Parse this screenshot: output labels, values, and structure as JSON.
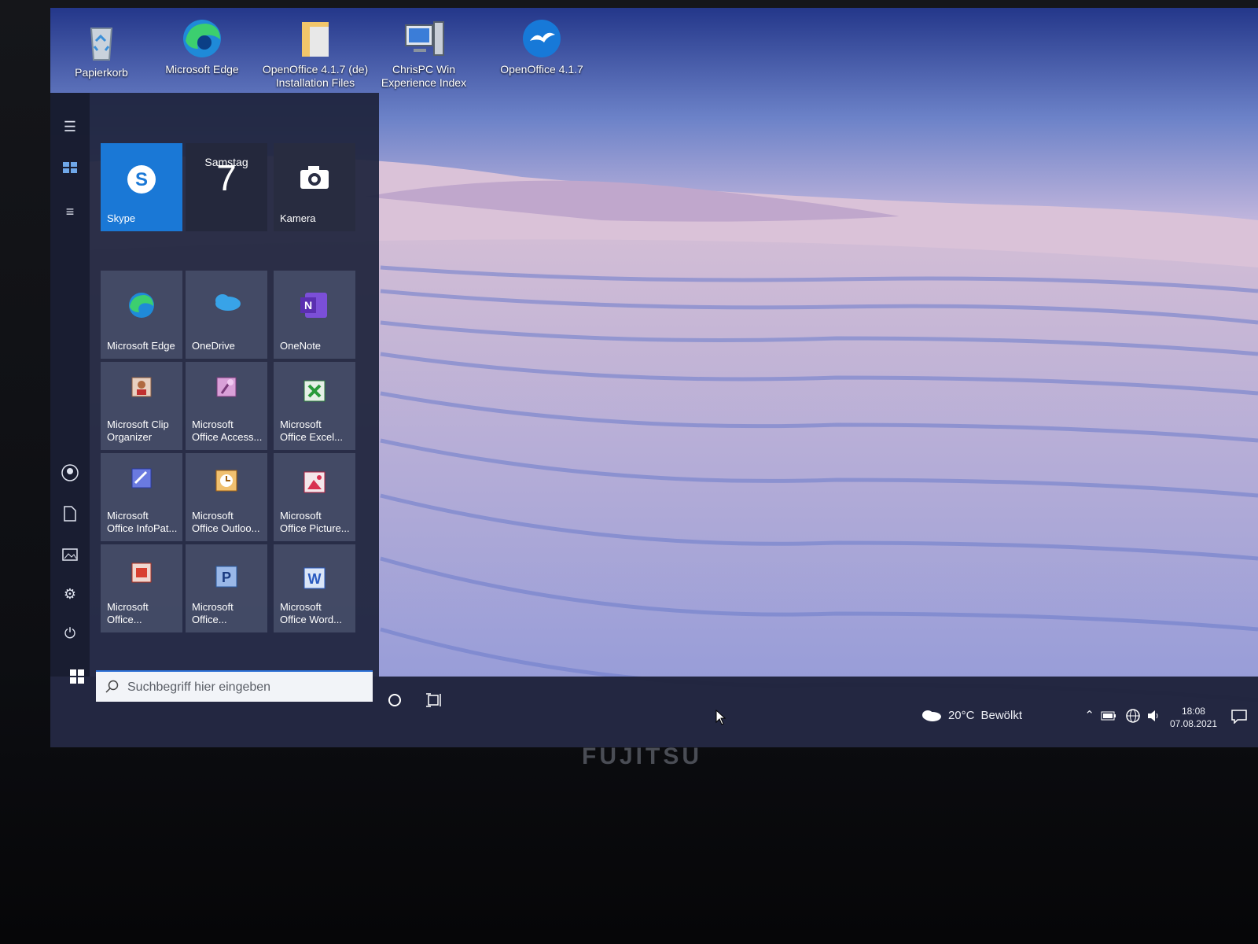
{
  "desktop": {
    "icons": [
      {
        "label_line1": "Papierkorb",
        "label_line2": "",
        "icon": "recycle-bin-icon"
      },
      {
        "label_line1": "Microsoft Edge",
        "label_line2": "",
        "icon": "edge-icon"
      },
      {
        "label_line1": "OpenOffice 4.1.7 (de)",
        "label_line2": "Installation Files",
        "icon": "folder-icon"
      },
      {
        "label_line1": "ChrisPC Win",
        "label_line2": "Experience Index",
        "icon": "computer-icon"
      },
      {
        "label_line1": "OpenOffice 4.1.7",
        "label_line2": "",
        "icon": "openoffice-icon"
      }
    ]
  },
  "start_menu": {
    "rail": [
      "hamburger-menu-icon",
      "tiles-icon",
      "all-apps-icon",
      "user-icon",
      "documents-icon",
      "pictures-icon",
      "settings-icon",
      "power-icon"
    ],
    "tiles_top": [
      {
        "label": "Skype",
        "color": "#1a78d6"
      },
      {
        "day": "Samstag",
        "date": "7"
      },
      {
        "label": "Kamera"
      }
    ],
    "tiles": [
      {
        "label_line1": "Microsoft Edge",
        "label_line2": ""
      },
      {
        "label_line1": "OneDrive",
        "label_line2": ""
      },
      {
        "label_line1": "OneNote",
        "label_line2": ""
      },
      {
        "label_line1": "Microsoft Clip",
        "label_line2": "Organizer"
      },
      {
        "label_line1": "Microsoft",
        "label_line2": "Office Access..."
      },
      {
        "label_line1": "Microsoft",
        "label_line2": "Office Excel..."
      },
      {
        "label_line1": "Microsoft",
        "label_line2": "Office InfoPat..."
      },
      {
        "label_line1": "Microsoft",
        "label_line2": "Office Outloo..."
      },
      {
        "label_line1": "Microsoft",
        "label_line2": "Office Picture..."
      },
      {
        "label_line1": "Microsoft",
        "label_line2": "Office..."
      },
      {
        "label_line1": "Microsoft",
        "label_line2": "Office..."
      },
      {
        "label_line1": "Microsoft",
        "label_line2": "Office Word..."
      }
    ]
  },
  "taskbar": {
    "search_placeholder": "Suchbegriff hier eingeben",
    "weather_temp": "20°C",
    "weather_text": "Bewölkt",
    "time": "18:08",
    "date": "07.08.2021"
  },
  "bezel": {
    "brand": "FUJITSU"
  }
}
